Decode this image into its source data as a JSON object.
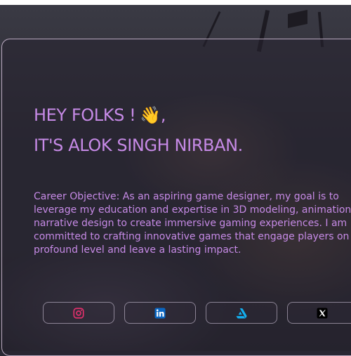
{
  "hero": {
    "greeting": "HEY FOLKS !",
    "wave_emoji": "👋,",
    "intro": "IT'S ALOK SINGH NIRBAN."
  },
  "objective": {
    "text": "Career Objective: As an aspiring game designer, my goal is to\nleverage my education and expertise in 3D modeling, animation, and\nnarrative design to create immersive gaming experiences. I am\ncommitted to crafting innovative games that engage players on a\nprofound level and leave a lasting impact."
  },
  "social_links": [
    {
      "name": "instagram",
      "icon": "instagram-icon",
      "color": "#e1306c"
    },
    {
      "name": "linkedin",
      "icon": "linkedin-icon",
      "color": "#0a66c2"
    },
    {
      "name": "artstation",
      "icon": "artstation-icon",
      "color": "#13aff0"
    },
    {
      "name": "x",
      "icon": "x-icon",
      "color": "#000000"
    }
  ],
  "colors": {
    "accent": "#c68ae6",
    "card_border": "#ebd7f0"
  }
}
